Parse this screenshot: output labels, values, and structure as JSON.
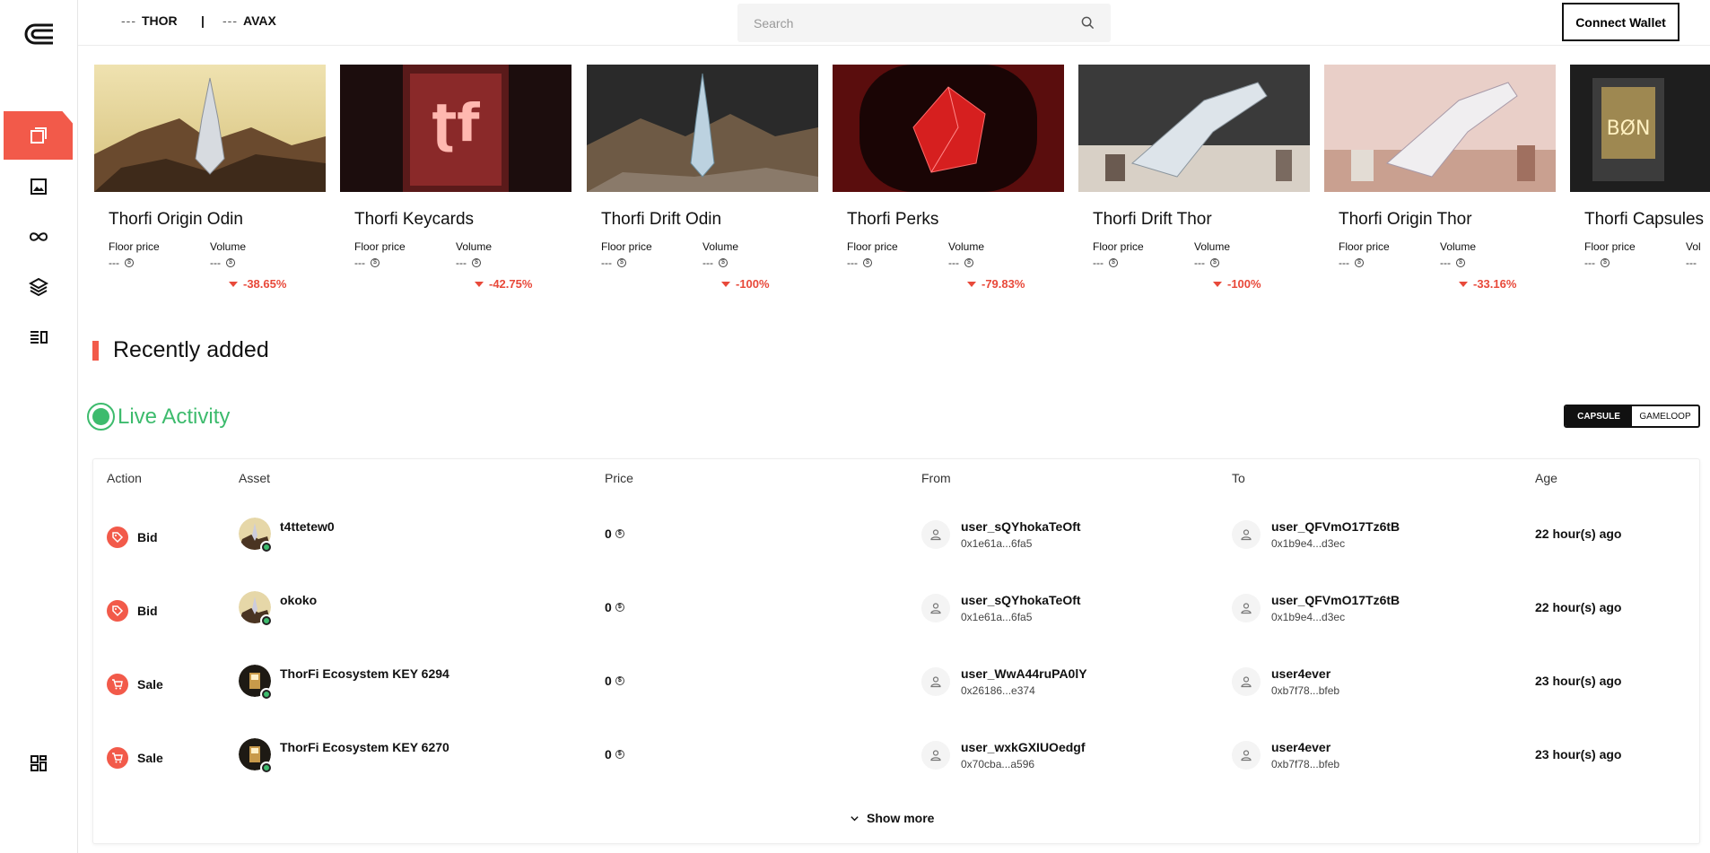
{
  "topbar": {
    "tickers": [
      {
        "value": "---",
        "symbol": "THOR"
      },
      {
        "value": "---",
        "symbol": "AVAX"
      }
    ],
    "separator": "|",
    "search_placeholder": "Search",
    "connect_label": "Connect Wallet"
  },
  "sidebar": {
    "items": [
      {
        "icon": "collections-icon",
        "active": true
      },
      {
        "icon": "image-icon",
        "active": false
      },
      {
        "icon": "infinity-icon",
        "active": false
      },
      {
        "icon": "layers-icon",
        "active": false
      },
      {
        "icon": "list-icon",
        "active": false
      },
      {
        "icon": "dashboard-icon",
        "active": false
      }
    ]
  },
  "collections": [
    {
      "name": "Thorfi Origin Odin",
      "floor_label": "Floor price",
      "volume_label": "Volume",
      "floor": "---",
      "volume": "---",
      "change": "-38.65%"
    },
    {
      "name": "Thorfi Keycards",
      "floor_label": "Floor price",
      "volume_label": "Volume",
      "floor": "---",
      "volume": "---",
      "change": "-42.75%"
    },
    {
      "name": "Thorfi Drift Odin",
      "floor_label": "Floor price",
      "volume_label": "Volume",
      "floor": "---",
      "volume": "---",
      "change": "-100%"
    },
    {
      "name": "Thorfi Perks",
      "floor_label": "Floor price",
      "volume_label": "Volume",
      "floor": "---",
      "volume": "---",
      "change": "-79.83%"
    },
    {
      "name": "Thorfi Drift Thor",
      "floor_label": "Floor price",
      "volume_label": "Volume",
      "floor": "---",
      "volume": "---",
      "change": "-100%"
    },
    {
      "name": "Thorfi Origin Thor",
      "floor_label": "Floor price",
      "volume_label": "Volume",
      "floor": "---",
      "volume": "---",
      "change": "-33.16%"
    },
    {
      "name": "Thorfi Capsules",
      "floor_label": "Floor price",
      "volume_label": "Vol",
      "floor": "---",
      "volume": "---",
      "change": ""
    }
  ],
  "recently_added": {
    "title": "Recently added"
  },
  "live_activity": {
    "title": "Live Activity",
    "toggle": {
      "capsule": "CAPSULE",
      "gameloop": "GAMELOOP"
    },
    "columns": [
      "Action",
      "Asset",
      "Price",
      "From",
      "To",
      "Age"
    ],
    "rows": [
      {
        "action": "Bid",
        "asset": "t4ttetew0",
        "price": "0",
        "from_name": "user_sQYhokaTeOft",
        "from_addr": "0x1e61a...6fa5",
        "to_name": "user_QFVmO17Tz6tB",
        "to_addr": "0x1b9e4...d3ec",
        "age": "22 hour(s) ago"
      },
      {
        "action": "Bid",
        "asset": "okoko",
        "price": "0",
        "from_name": "user_sQYhokaTeOft",
        "from_addr": "0x1e61a...6fa5",
        "to_name": "user_QFVmO17Tz6tB",
        "to_addr": "0x1b9e4...d3ec",
        "age": "22 hour(s) ago"
      },
      {
        "action": "Sale",
        "asset": "ThorFi Ecosystem KEY 6294",
        "price": "0",
        "from_name": "user_WwA44ruPA0lY",
        "from_addr": "0x26186...e374",
        "to_name": "user4ever",
        "to_addr": "0xb7f78...bfeb",
        "age": "23 hour(s) ago"
      },
      {
        "action": "Sale",
        "asset": "ThorFi Ecosystem KEY 6270",
        "price": "0",
        "from_name": "user_wxkGXIUOedgf",
        "from_addr": "0x70cba...a596",
        "to_name": "user4ever",
        "to_addr": "0xb7f78...bfeb",
        "age": "23 hour(s) ago"
      }
    ],
    "show_more": "Show more"
  },
  "colors": {
    "accent": "#f25a4a",
    "live": "#3dbb6d",
    "negative": "#e8493a"
  }
}
